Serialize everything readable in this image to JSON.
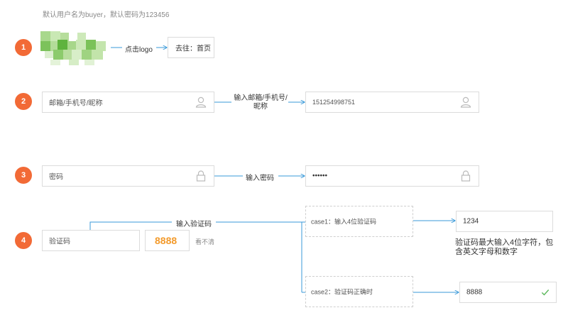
{
  "note": "默认用户名为buyer，默认密码为123456",
  "steps": [
    "1",
    "2",
    "3",
    "4"
  ],
  "row1": {
    "action": "点击logo",
    "target": "去往：首页"
  },
  "row2": {
    "input_placeholder": "邮箱/手机号/昵称",
    "action": "输入邮箱/手机号/昵称",
    "result_value": "151254998751",
    "icon": "user-icon"
  },
  "row3": {
    "input_placeholder": "密码",
    "action": "输入密码",
    "result_value": "••••••",
    "icon": "lock-icon"
  },
  "row4": {
    "input_placeholder": "验证码",
    "captcha": "8888",
    "refresh_text": "看不清",
    "action": "输入验证码",
    "case1": {
      "label": "case1：输入4位验证码",
      "result_value": "1234",
      "hint": "验证码最大输入4位字符，包含英文字母和数字"
    },
    "case2": {
      "label": "case2：验证码正确时",
      "result_value": "8888",
      "icon": "check-icon"
    }
  },
  "colors": {
    "step": "#f26a36",
    "arrow": "#3a9ad9",
    "captcha": "#f39a2b",
    "check": "#5cb85c"
  }
}
